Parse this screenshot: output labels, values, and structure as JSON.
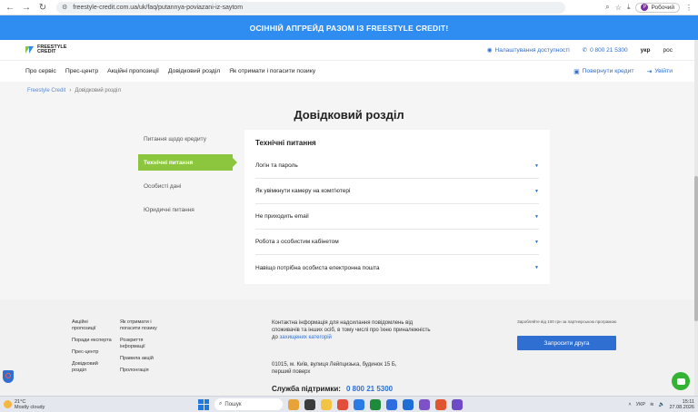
{
  "browser": {
    "url": "freestyle-credit.com.ua/uk/faq/putannya-poviazani-iz-saytom",
    "profile_label": "Робочий",
    "profile_initial": "Р"
  },
  "promo": {
    "text": "ОСІННІЙ АПГРЕЙД РАЗОМ ІЗ FREESTYLE CREDIT!"
  },
  "header": {
    "logo_line1": "FREESTYLE",
    "logo_line2": "CREDIT",
    "accessibility": "Налаштування доступності",
    "phone": "0 800 21 5300",
    "lang_uk": "укр",
    "lang_ru": "рос"
  },
  "nav": {
    "items": [
      "Про сервіс",
      "Прес-центр",
      "Акційні пропозиції",
      "Довідковий розділ",
      "Як отримати і погасити позику"
    ],
    "repay": "Повернути кредит",
    "login": "Увійти"
  },
  "breadcrumb": {
    "home": "Freestyle Credit",
    "sep": "›",
    "current": "Довідковий розділ"
  },
  "page_title": "Довідковий розділ",
  "side_menu": [
    "Питання щодо кредиту",
    "Технічні питання",
    "Особисті дані",
    "Юридичні питання"
  ],
  "panel": {
    "title": "Технічні питання",
    "questions": [
      "Логін та пароль",
      "Як увімкнути камеру на комп'ютері",
      "Не приходить email",
      "Робота з особистим кабінетом",
      "Навіщо потрібна особиста електронна пошта"
    ]
  },
  "footer": {
    "col1": [
      "Акційні пропозиції",
      "Поради експерта",
      "Прес-центр",
      "Довідковий розділ"
    ],
    "col2": [
      "Як отримати і погасити позику",
      "Розкриття інформації",
      "Правила акцій",
      "Пролонгація"
    ],
    "contact_text": "Контактна інформація для надсилання повідомлень від споживачів та інших осіб, в тому числі про їхню приналежність до",
    "contact_link": "захищених категорій",
    "address": "01015, м. Київ, вулиця Лейпцизька, будинок 15 Б, перший поверх",
    "support_label": "Служба підтримки:",
    "support_phone": "0 800 21 5300",
    "invite_note": "Заробляйте від 100 грн за партнерською програмою",
    "invite_button": "Запросити друга"
  },
  "taskbar": {
    "temp": "21°C",
    "weather": "Mostly cloudy",
    "search": "Пошук",
    "lang": "УКР",
    "time": "15:11",
    "date": "27.08.2026"
  }
}
